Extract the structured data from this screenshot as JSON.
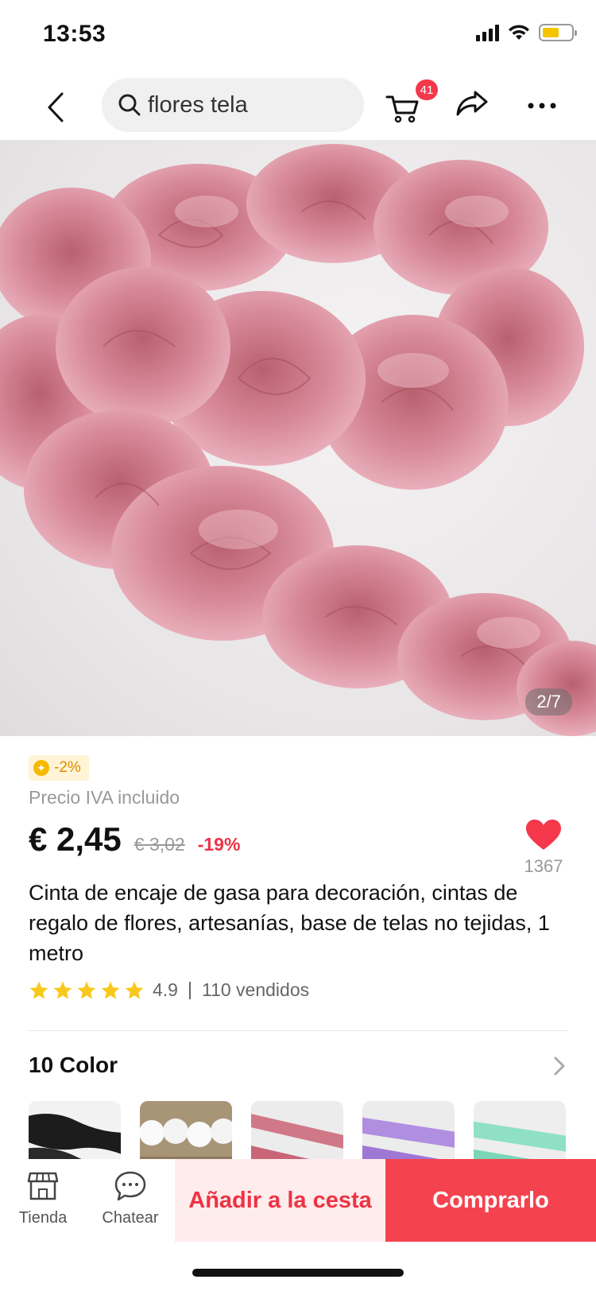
{
  "status_bar": {
    "time": "13:53"
  },
  "nav": {
    "search_text": "flores tela",
    "cart_badge": "41"
  },
  "gallery": {
    "counter": "2/7"
  },
  "product": {
    "coin_discount": "-2%",
    "vat_label": "Precio IVA incluido",
    "price": "€ 2,45",
    "original_price": "€ 3,02",
    "discount": "-19%",
    "wishlist_count": "1367",
    "title": "Cinta de encaje de gasa para decoración, cintas de regalo de flores, artesanías, base de telas no tejidas, 1 metro",
    "rating": "4.9",
    "sold": "110 vendidos",
    "stars": 5
  },
  "colors": {
    "title": "10 Color",
    "swatches": [
      "black",
      "white",
      "pink",
      "lavender",
      "mint"
    ]
  },
  "bottom_bar": {
    "store_label": "Tienda",
    "chat_label": "Chatear",
    "add_to_cart": "Añadir a la cesta",
    "buy_now": "Comprarlo"
  },
  "theme": {
    "accent": "#f5424f",
    "star": "#f8c91c",
    "product_pink": "#d88a9a"
  }
}
